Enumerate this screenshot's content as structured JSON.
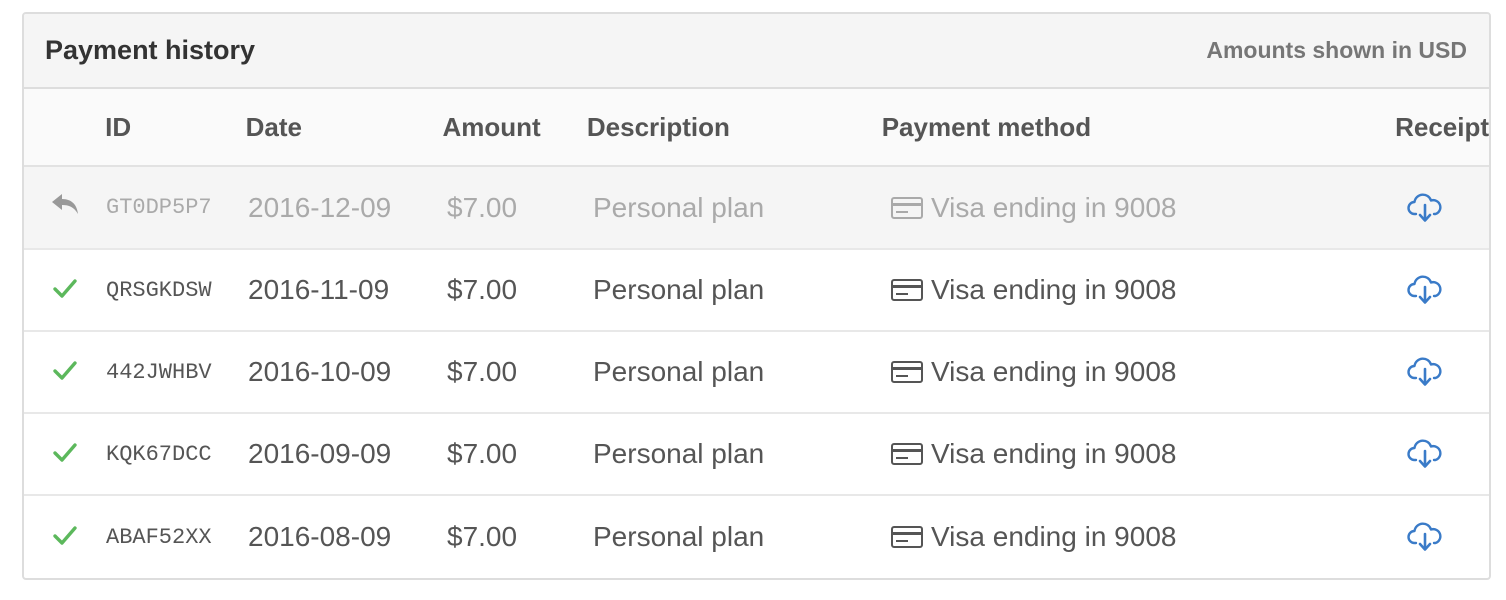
{
  "panel": {
    "title": "Payment history",
    "currency_note": "Amounts shown in USD"
  },
  "columns": {
    "id": "ID",
    "date": "Date",
    "amount": "Amount",
    "description": "Description",
    "method": "Payment method",
    "receipt": "Receipt"
  },
  "rows": [
    {
      "status": "refunded",
      "status_icon": "reply-arrow-icon",
      "id": "GT0DP5P7",
      "date": "2016-12-09",
      "amount": "$7.00",
      "description": "Personal plan",
      "method": "Visa ending in 9008"
    },
    {
      "status": "paid",
      "status_icon": "checkmark-icon",
      "id": "QRSGKDSW",
      "date": "2016-11-09",
      "amount": "$7.00",
      "description": "Personal plan",
      "method": "Visa ending in 9008"
    },
    {
      "status": "paid",
      "status_icon": "checkmark-icon",
      "id": "442JWHBV",
      "date": "2016-10-09",
      "amount": "$7.00",
      "description": "Personal plan",
      "method": "Visa ending in 9008"
    },
    {
      "status": "paid",
      "status_icon": "checkmark-icon",
      "id": "KQK67DCC",
      "date": "2016-09-09",
      "amount": "$7.00",
      "description": "Personal plan",
      "method": "Visa ending in 9008"
    },
    {
      "status": "paid",
      "status_icon": "checkmark-icon",
      "id": "ABAF52XX",
      "date": "2016-08-09",
      "amount": "$7.00",
      "description": "Personal plan",
      "method": "Visa ending in 9008"
    }
  ],
  "colors": {
    "success": "#5cb85c",
    "refund": "#999999",
    "link": "#3a7bc8",
    "muted_text": "#aaaaaa"
  }
}
